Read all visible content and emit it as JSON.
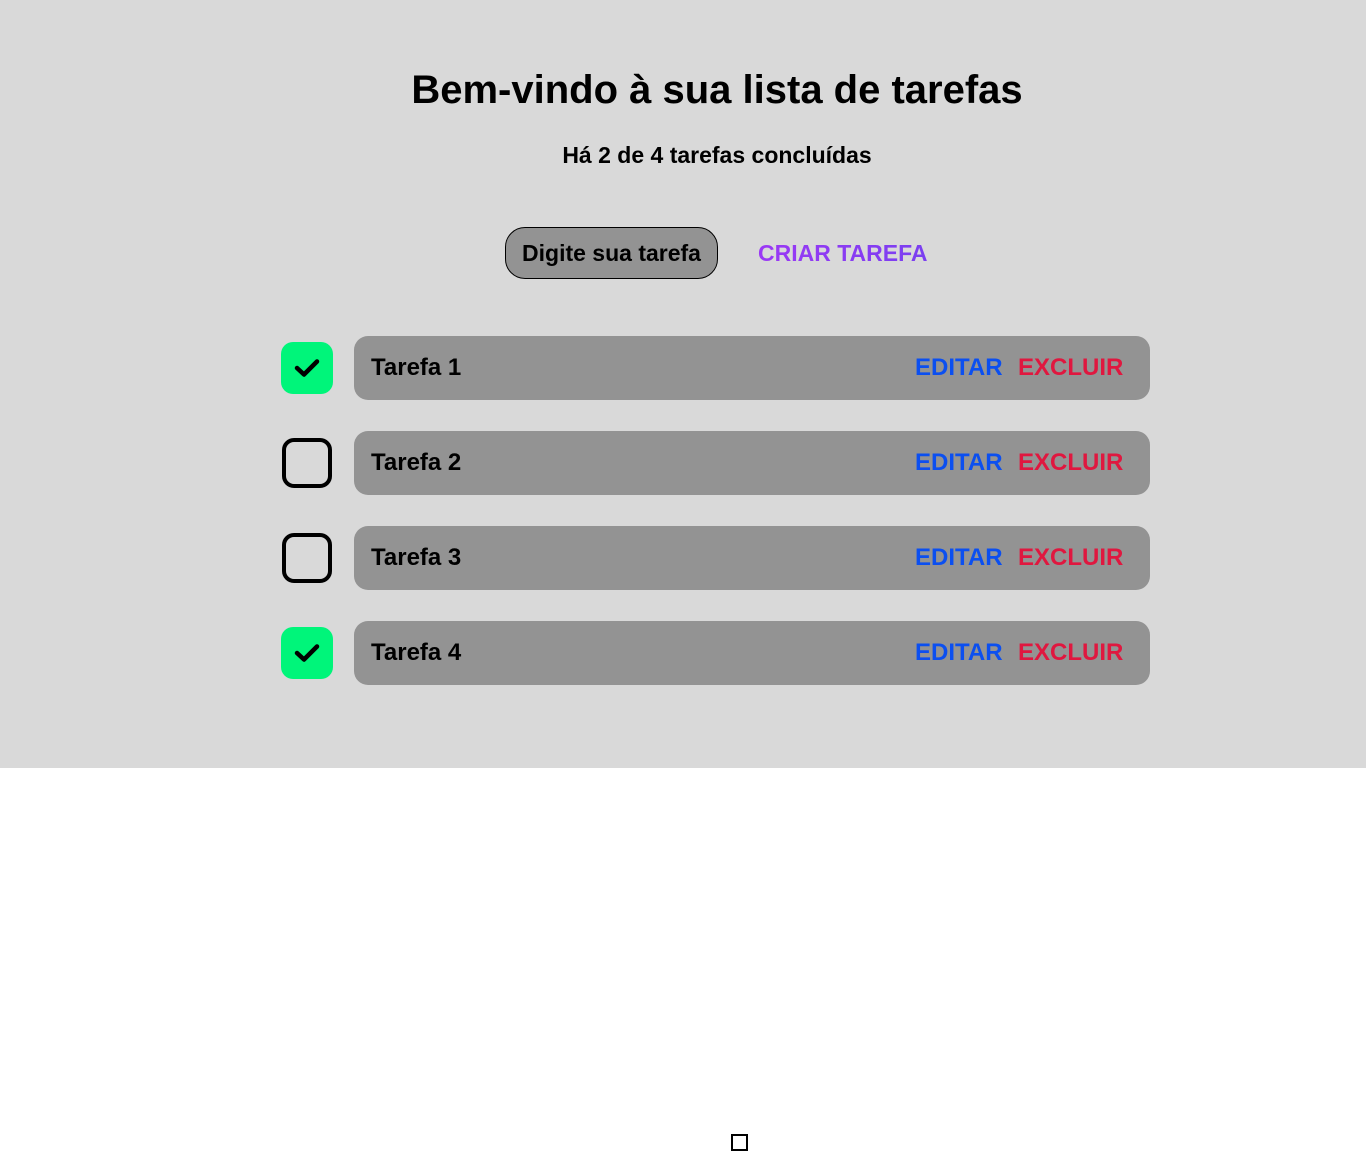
{
  "header": {
    "title": "Bem-vindo à sua lista de tarefas",
    "subtitle": "Há 2 de 4 tarefas concluídas"
  },
  "form": {
    "input_placeholder": "Digite sua tarefa",
    "input_value": "",
    "create_label": "CRIAR TAREFA"
  },
  "colors": {
    "background": "#d9d9d9",
    "task_bar": "#939393",
    "done_check": "#00f57a",
    "edit": "#0b4ff0",
    "delete": "#e0173f",
    "create": "#9b38f5"
  },
  "tasks": [
    {
      "name": "Tarefa 1",
      "done": true,
      "edit_label": "EDITAR",
      "delete_label": "EXCLUIR"
    },
    {
      "name": "Tarefa 2",
      "done": false,
      "edit_label": "EDITAR",
      "delete_label": "EXCLUIR"
    },
    {
      "name": "Tarefa 3",
      "done": false,
      "edit_label": "EDITAR",
      "delete_label": "EXCLUIR"
    },
    {
      "name": "Tarefa 4",
      "done": true,
      "edit_label": "EDITAR",
      "delete_label": "EXCLUIR"
    }
  ]
}
